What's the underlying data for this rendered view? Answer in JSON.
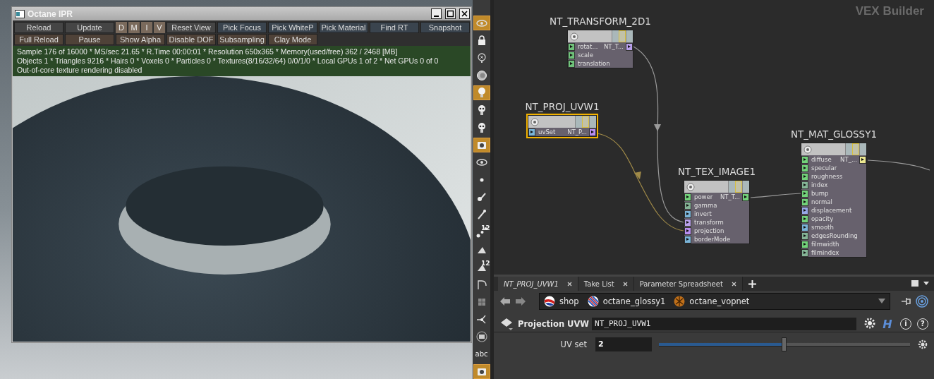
{
  "ipr": {
    "title": "Octane IPR",
    "toolbar_rows": [
      [
        {
          "kind": "plain",
          "label": "Reload"
        },
        {
          "kind": "plain",
          "label": "Update"
        },
        {
          "kind": "toggles",
          "letters": [
            "D",
            "M",
            "I",
            "V"
          ]
        },
        {
          "kind": "plain",
          "label": "Reset View"
        },
        {
          "kind": "blue",
          "label": "Pick Focus"
        },
        {
          "kind": "blue",
          "label": "Pick WhiteP"
        },
        {
          "kind": "blue",
          "label": "Pick Material"
        },
        {
          "kind": "blue",
          "label": "Find RT"
        },
        {
          "kind": "blue",
          "label": "Snapshot"
        }
      ],
      [
        {
          "kind": "brown",
          "label": "Full Reload"
        },
        {
          "kind": "brown",
          "label": "Pause"
        },
        {
          "kind": "brown",
          "label": "Show Alpha"
        },
        {
          "kind": "brown",
          "label": "Disable DOF"
        },
        {
          "kind": "brown",
          "label": "Subsampling"
        },
        {
          "kind": "brown",
          "label": "Clay Mode"
        }
      ]
    ],
    "status_lines": [
      "Sample 176 of 16000 * MS/sec 21.65 * R.Time 00:00:01 * Resolution 650x365 * Memory(used/free) 362 / 2468 [MB]",
      "Objects 1 * Triangles 9216 * Hairs 0 * Voxels 0 * Particles 0 * Textures(8/16/32/64) 0/0/1/0 * Local GPUs 1 of 2 * Net GPUs 0 of 0",
      "Out-of-core texture rendering disabled"
    ]
  },
  "tools": [
    {
      "kind": "eye",
      "selected": true
    },
    {
      "kind": "lock",
      "selected": false
    },
    {
      "kind": "light-cross",
      "selected": false
    },
    {
      "kind": "sphere",
      "selected": false
    },
    {
      "kind": "bulb",
      "selected": true
    },
    {
      "kind": "skull",
      "selected": false
    },
    {
      "kind": "skull",
      "selected": false
    },
    {
      "kind": "camera",
      "selected": true
    },
    {
      "kind": "eye",
      "selected": false
    },
    {
      "kind": "dot",
      "selected": false
    },
    {
      "kind": "brush",
      "selected": false
    },
    {
      "kind": "pen",
      "selected": false
    },
    {
      "kind": "points",
      "selected": false,
      "label": "12"
    },
    {
      "kind": "paint",
      "selected": false
    },
    {
      "kind": "paint",
      "selected": false,
      "label": "12"
    },
    {
      "kind": "curve",
      "selected": false
    },
    {
      "kind": "box",
      "selected": false
    },
    {
      "kind": "axes",
      "selected": false
    },
    {
      "kind": "disc",
      "selected": false
    },
    {
      "kind": "text",
      "selected": false,
      "label": "abc"
    },
    {
      "kind": "camera",
      "selected": true
    }
  ],
  "network": {
    "context_label": "VEX Builder",
    "nodes": [
      {
        "name": "NT_TRANSFORM_2D1",
        "selected": false,
        "output": {
          "label": "NT_T...",
          "color": "#b9a0ec"
        },
        "inputs": [
          {
            "label": "rotat...",
            "color": "#6fc27a"
          },
          {
            "label": "scale",
            "color": "#6fc27a"
          },
          {
            "label": "translation",
            "color": "#6fc27a"
          }
        ]
      },
      {
        "name": "NT_PROJ_UVW1",
        "selected": true,
        "output": {
          "label": "NT_P...",
          "color": "#b98ef0"
        },
        "inputs": [
          {
            "label": "uvSet",
            "color": "#7ab4d8"
          }
        ]
      },
      {
        "name": "NT_TEX_IMAGE1",
        "selected": false,
        "output": {
          "label": "NT_T...",
          "color": "#72d27a"
        },
        "inputs": [
          {
            "label": "power",
            "color": "#72d27a"
          },
          {
            "label": "gamma",
            "color": "#84b496"
          },
          {
            "label": "invert",
            "color": "#7ab4d8"
          },
          {
            "label": "transform",
            "color": "#b9a0ec"
          },
          {
            "label": "projection",
            "color": "#b98ef0"
          },
          {
            "label": "borderMode",
            "color": "#7ab4d8"
          }
        ]
      },
      {
        "name": "NT_MAT_GLOSSY1",
        "selected": false,
        "output": {
          "label": "NT_...",
          "color": "#ece890"
        },
        "inputs": [
          {
            "label": "diffuse",
            "color": "#72d27a"
          },
          {
            "label": "specular",
            "color": "#72d27a"
          },
          {
            "label": "roughness",
            "color": "#72d27a"
          },
          {
            "label": "index",
            "color": "#84b496"
          },
          {
            "label": "bump",
            "color": "#72d27a"
          },
          {
            "label": "normal",
            "color": "#72d27a"
          },
          {
            "label": "displacement",
            "color": "#98a8e8"
          },
          {
            "label": "opacity",
            "color": "#72d27a"
          },
          {
            "label": "smooth",
            "color": "#7ab4d8"
          },
          {
            "label": "edgesRounding",
            "color": "#84b496"
          },
          {
            "label": "filmwidth",
            "color": "#72d27a"
          },
          {
            "label": "filmindex",
            "color": "#84b496"
          }
        ]
      }
    ]
  },
  "pane": {
    "tabs": [
      {
        "label": "NT_PROJ_UVW1",
        "selected": true
      },
      {
        "label": "Take List",
        "selected": false
      },
      {
        "label": "Parameter Spreadsheet",
        "selected": false
      }
    ],
    "path": [
      "shop",
      "octane_glossy1",
      "octane_vopnet"
    ],
    "node_type": "Projection UVW",
    "node_name": "NT_PROJ_UVW1",
    "hda_glyph": "H",
    "info_glyph": "i",
    "help_glyph": "?",
    "parameters": [
      {
        "label": "UV set",
        "value": "2",
        "level": 0.5
      }
    ]
  }
}
